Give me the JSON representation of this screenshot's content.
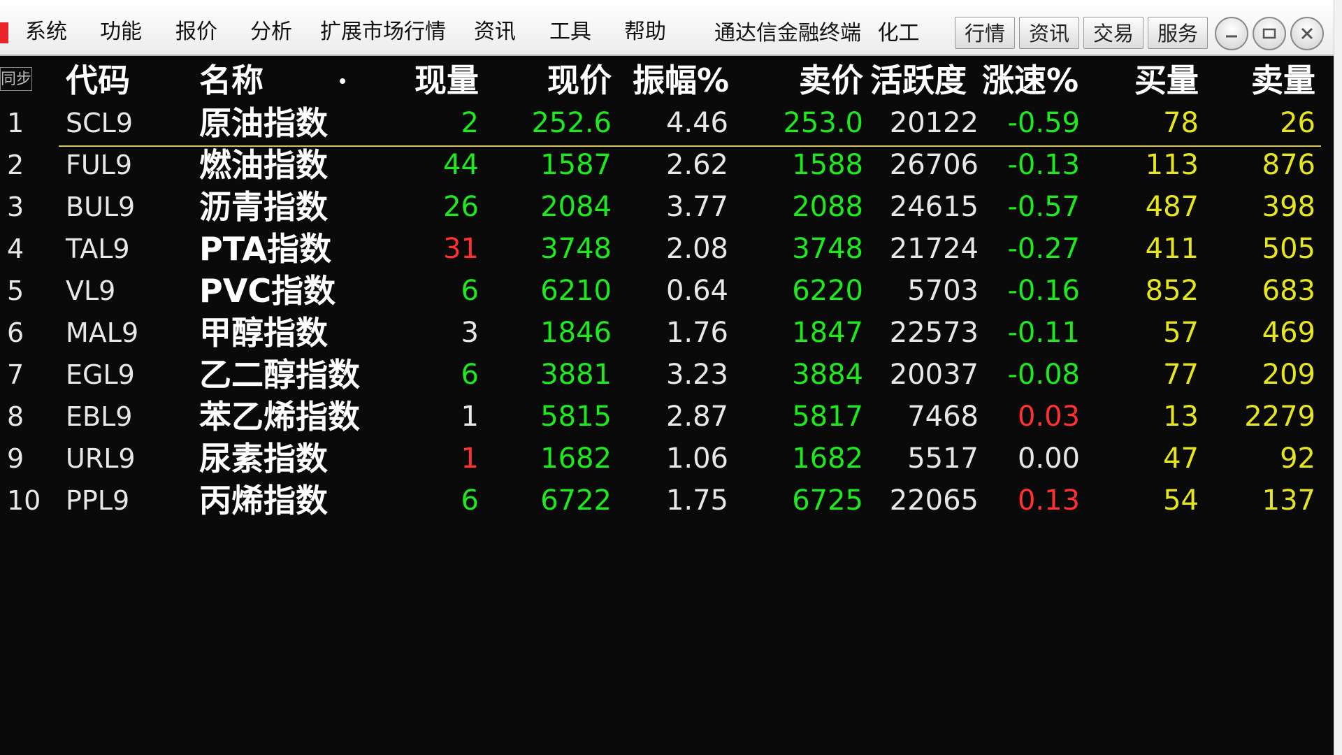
{
  "menu": {
    "items": [
      "系统",
      "功能",
      "报价",
      "分析",
      "扩展市场行情",
      "资讯",
      "工具",
      "帮助"
    ],
    "title": "通达信金融终端",
    "sector": "化工"
  },
  "toolbar": {
    "tabs": [
      "行情",
      "资讯",
      "交易",
      "服务"
    ],
    "window_controls": [
      "minimize-icon",
      "restore-icon",
      "close-icon"
    ]
  },
  "table": {
    "sync_label": "同步",
    "headers": {
      "code": "代码",
      "name": "名称",
      "vol": "现量",
      "price": "现价",
      "amp": "振幅%",
      "ask": "卖价",
      "act": "活跃度",
      "spd": "涨速%",
      "bidv": "买量",
      "askv": "卖量"
    },
    "rows": [
      {
        "idx": "1",
        "code": "SCL9",
        "name": "原油指数",
        "vol": "2",
        "price": "252.6",
        "amp": "4.46",
        "ask": "253.0",
        "act": "20122",
        "spd": "-0.59",
        "bidv": "78",
        "askv": "26"
      },
      {
        "idx": "2",
        "code": "FUL9",
        "name": "燃油指数",
        "vol": "44",
        "price": "1587",
        "amp": "2.62",
        "ask": "1588",
        "act": "26706",
        "spd": "-0.13",
        "bidv": "113",
        "askv": "876"
      },
      {
        "idx": "3",
        "code": "BUL9",
        "name": "沥青指数",
        "vol": "26",
        "price": "2084",
        "amp": "3.77",
        "ask": "2088",
        "act": "24615",
        "spd": "-0.57",
        "bidv": "487",
        "askv": "398"
      },
      {
        "idx": "4",
        "code": "TAL9",
        "name": "PTA指数",
        "vol": "31",
        "price": "3748",
        "amp": "2.08",
        "ask": "3748",
        "act": "21724",
        "spd": "-0.27",
        "bidv": "411",
        "askv": "505"
      },
      {
        "idx": "5",
        "code": "VL9",
        "name": "PVC指数",
        "vol": "6",
        "price": "6210",
        "amp": "0.64",
        "ask": "6220",
        "act": "5703",
        "spd": "-0.16",
        "bidv": "852",
        "askv": "683"
      },
      {
        "idx": "6",
        "code": "MAL9",
        "name": "甲醇指数",
        "vol": "3",
        "price": "1846",
        "amp": "1.76",
        "ask": "1847",
        "act": "22573",
        "spd": "-0.11",
        "bidv": "57",
        "askv": "469"
      },
      {
        "idx": "7",
        "code": "EGL9",
        "name": "乙二醇指数",
        "vol": "6",
        "price": "3881",
        "amp": "3.23",
        "ask": "3884",
        "act": "20037",
        "spd": "-0.08",
        "bidv": "77",
        "askv": "209"
      },
      {
        "idx": "8",
        "code": "EBL9",
        "name": "苯乙烯指数",
        "vol": "1",
        "price": "5815",
        "amp": "2.87",
        "ask": "5817",
        "act": "7468",
        "spd": "0.03",
        "bidv": "13",
        "askv": "2279"
      },
      {
        "idx": "9",
        "code": "URL9",
        "name": "尿素指数",
        "vol": "1",
        "price": "1682",
        "amp": "1.06",
        "ask": "1682",
        "act": "5517",
        "spd": "0.00",
        "bidv": "47",
        "askv": "92"
      },
      {
        "idx": "10",
        "code": "PPL9",
        "name": "丙烯指数",
        "vol": "6",
        "price": "6722",
        "amp": "1.75",
        "ask": "6725",
        "act": "22065",
        "spd": "0.13",
        "bidv": "54",
        "askv": "137"
      }
    ],
    "vol_colors": [
      "green",
      "green",
      "green",
      "red",
      "green",
      "white",
      "green",
      "white",
      "red",
      "green"
    ],
    "spd_colors": [
      "green",
      "green",
      "green",
      "green",
      "green",
      "green",
      "green",
      "red",
      "white",
      "red"
    ],
    "colors": {
      "up": "#ff3030",
      "down": "#1ee81e",
      "flat": "#e8e8e8",
      "volume": "#e6e61e",
      "selection": "#d4c25a",
      "background": "#0a0a0a"
    }
  }
}
